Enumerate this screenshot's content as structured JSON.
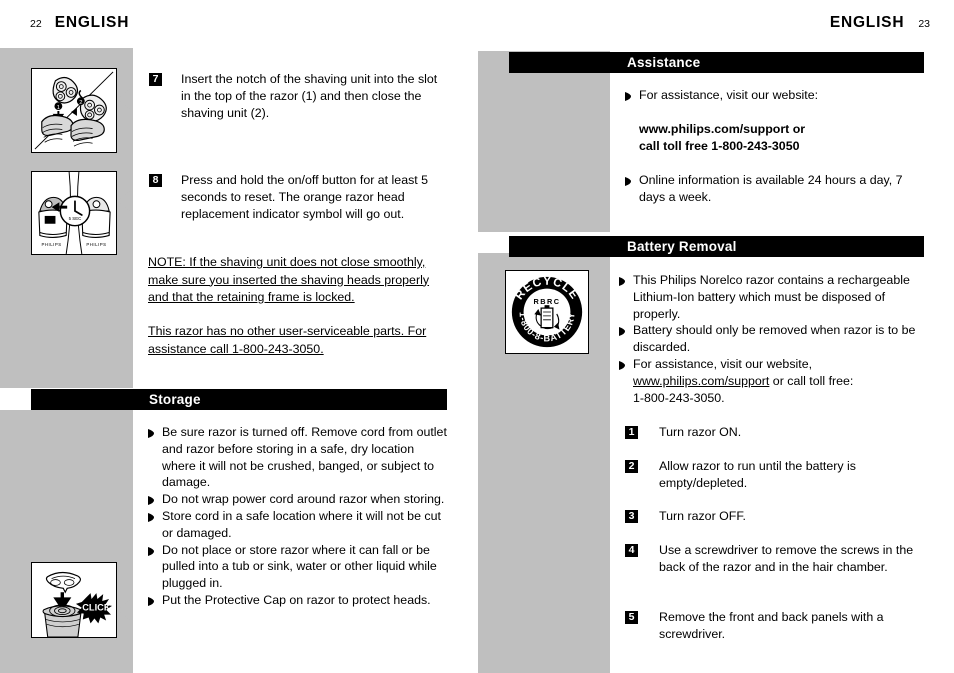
{
  "document": {
    "type": "product-manual-spread",
    "colors": {
      "page_background": "#ffffff",
      "sidebar_gray": "#bfbfbf",
      "section_bar": "#000000",
      "section_bar_text": "#ffffff",
      "body_text": "#000000"
    }
  },
  "left_page": {
    "header": {
      "page_number": "22",
      "title": "ENGLISH"
    },
    "steps": [
      {
        "number": "7",
        "text": "Insert the notch of the shaving unit into the slot in the top of the razor (1) and then close the shaving unit (2)."
      },
      {
        "number": "8",
        "text": "Press and hold the on/off button for at least 5 seconds to reset. The orange razor head replacement indicator symbol will go out."
      }
    ],
    "notes": [
      "NOTE: If the shaving unit does not close smoothly, make sure you inserted the shaving heads properly and that the retaining frame is locked.",
      "This razor has no other user-serviceable parts. For assistance call 1-800-243-3050."
    ],
    "storage_section": {
      "title": "Storage",
      "bullets": [
        "Be sure razor is turned off. Remove cord from outlet and razor before storing in a safe, dry location where it will not be crushed, banged, or subject to damage.",
        "Do not wrap power cord around razor when storing.",
        "Store cord in a safe location where it will not be cut or damaged.",
        "Do not place or store razor where it can fall or be pulled into a tub or sink, water or other liquid while plugged in.",
        "Put the Protective Cap on razor to protect heads."
      ]
    },
    "illustrations": [
      {
        "name": "shaving-unit-insert-illustration",
        "caption": ""
      },
      {
        "name": "razor-reset-button-illustration",
        "caption": ""
      },
      {
        "name": "protective-cap-click-illustration",
        "caption": "CLICK"
      }
    ],
    "illustration_labels": {
      "brand_mark": "PHILIPS",
      "click_label": "CLICK",
      "timer_label": "5 SEC",
      "marker_1": "1",
      "marker_2": "2"
    }
  },
  "right_page": {
    "header": {
      "page_number": "23",
      "title": "ENGLISH"
    },
    "assistance_section": {
      "title": "Assistance",
      "bullets": [
        "For assistance, visit our website:",
        "Online information is available 24 hours a day, 7 days a week."
      ],
      "contact_line_1": "www.philips.com/support or",
      "contact_line_2": "call toll free 1-800-243-3050"
    },
    "battery_section": {
      "title": "Battery Removal",
      "bullets": [
        "This Philips Norelco razor contains a rechargeable Lithium-Ion battery which must be disposed of properly.",
        "Battery should only be removed when razor is to be discarded.",
        "For assistance, visit our website,"
      ],
      "assistance_link": "www.philips.com/support",
      "assistance_link_suffix": " or call toll free:",
      "assistance_phone": "1-800-243-3050.",
      "steps": [
        {
          "number": "1",
          "text": "Turn razor ON."
        },
        {
          "number": "2",
          "text": "Allow razor to run until the battery is empty/depleted."
        },
        {
          "number": "3",
          "text": "Turn razor OFF."
        },
        {
          "number": "4",
          "text": "Use a screwdriver to remove the screws in the back of the razor and in the hair chamber."
        },
        {
          "number": "5",
          "text": "Remove the front and back panels with a screwdriver."
        }
      ]
    },
    "recycle_logo": {
      "name": "rbrc-recycle-battery-logo",
      "top_text": "RECYCLE",
      "center_text": "RBRC",
      "bottom_text": "1-800-8-BATTERY"
    }
  }
}
